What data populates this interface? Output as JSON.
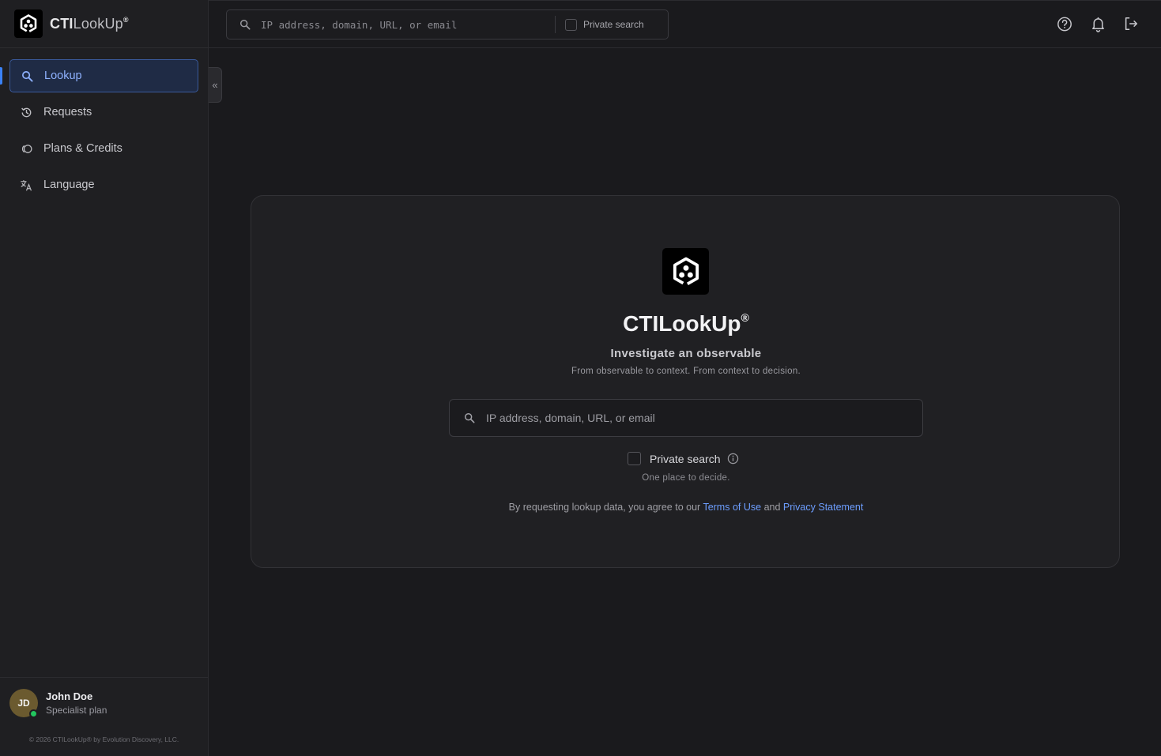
{
  "brand": {
    "name_bold": "CTI",
    "name_light": "LookUp",
    "reg": "®"
  },
  "sidebar": {
    "items": [
      {
        "label": "Lookup",
        "icon": "search-icon",
        "active": true
      },
      {
        "label": "Requests",
        "icon": "history-icon"
      },
      {
        "label": "Plans & Credits",
        "icon": "coins-icon"
      },
      {
        "label": "Language",
        "icon": "translate-icon"
      }
    ],
    "collapse_glyph": "«"
  },
  "user": {
    "initials": "JD",
    "name": "John Doe",
    "plan": "Specialist plan",
    "status_color": "#22c55e"
  },
  "footer": {
    "copyright": "© 2026 CTILookUp® by Evolution Discovery, LLC."
  },
  "topbar": {
    "search_placeholder": "IP address, domain, URL, or email",
    "private_label": "Private search",
    "icons": [
      "help-icon",
      "bell-icon",
      "logout-icon"
    ]
  },
  "main": {
    "title": "CTILookUp",
    "title_reg": "®",
    "subtitle": "Investigate an observable",
    "tagline": "From observable to context. From context to decision.",
    "search_placeholder": "IP address, domain, URL, or email",
    "private_label": "Private search",
    "private_hint": "One place to decide.",
    "legal_prefix": "By requesting lookup data, you agree to our",
    "terms_link": "Terms of Use",
    "legal_and": "and",
    "privacy_link": "Privacy Statement"
  },
  "colors": {
    "accent": "#3b82f6",
    "link": "#6d9eff",
    "background": "#1a1a1d"
  }
}
